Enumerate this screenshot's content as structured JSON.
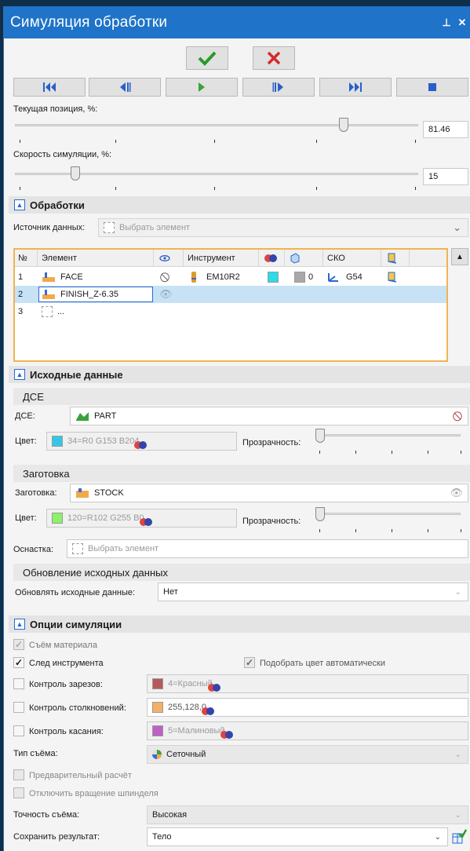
{
  "window": {
    "title": "Симуляция обработки",
    "pin_icon": "pin-icon",
    "close_icon": "close-icon"
  },
  "actions": {
    "ok_icon": "check-icon",
    "cancel_icon": "cross-icon"
  },
  "playback": [
    "rewind-to-start-icon",
    "step-back-icon",
    "play-icon",
    "step-forward-icon",
    "fast-forward-icon",
    "stop-icon"
  ],
  "position": {
    "label": "Текущая позиция, %:",
    "value": "81.46",
    "fraction": 0.8146
  },
  "speed": {
    "label": "Скорость симуляции, %:",
    "value": "15",
    "fraction": 0.15
  },
  "operations": {
    "title": "Обработки",
    "source_label": "Источник данных:",
    "source_placeholder": "Выбрать элемент",
    "columns": [
      "№",
      "Элемент",
      "Инструмент",
      "СКО"
    ],
    "rows": [
      {
        "num": "1",
        "element": "FACE",
        "tool": "EM10R2",
        "tool_num": "0",
        "cs": "G54"
      },
      {
        "num": "2",
        "element": "FINISH_Z-6.35"
      },
      {
        "num": "3",
        "element": "..."
      }
    ]
  },
  "source_data": {
    "title": "Исходные данные",
    "part": {
      "group": "ДСЕ",
      "label": "ДСЕ:",
      "value": "PART",
      "color_label": "Цвет:",
      "color_value": "34=R0 G153 B204",
      "color": "#33c7e6",
      "transparency_label": "Прозрачность:"
    },
    "stock": {
      "group": "Заготовка",
      "label": "Заготовка:",
      "value": "STOCK",
      "color_label": "Цвет:",
      "color_value": "120=R102 G255 B0",
      "color": "#8cf266",
      "transparency_label": "Прозрачность:"
    },
    "fixture": {
      "label": "Оснастка:",
      "placeholder": "Выбрать элемент"
    },
    "update": {
      "group": "Обновление исходных данных",
      "label": "Обновлять исходные данные:",
      "value": "Нет"
    }
  },
  "sim_options": {
    "title": "Опции симуляции",
    "material_removal": "Съём материала",
    "tool_trace": "След инструмента",
    "auto_color": "Подобрать цвет автоматически",
    "gouge_control": {
      "label": "Контроль зарезов:",
      "value": "4=Красный",
      "color": "#b55a5a"
    },
    "collision_control": {
      "label": "Контроль столкновений:",
      "value": "255,128,0",
      "color": "#f5b067"
    },
    "touch_control": {
      "label": "Контроль касания:",
      "value": "5=Малиновый",
      "color": "#bf60c6"
    },
    "removal_type": {
      "label": "Тип съёма:",
      "value": "Сеточный"
    },
    "precalc": "Предварительный расчёт",
    "spindle_off": "Отключить вращение шпинделя",
    "removal_accuracy": {
      "label": "Точность съёма:",
      "value": "Высокая"
    },
    "save_result": {
      "label": "Сохранить результат:",
      "value": "Тело"
    }
  }
}
